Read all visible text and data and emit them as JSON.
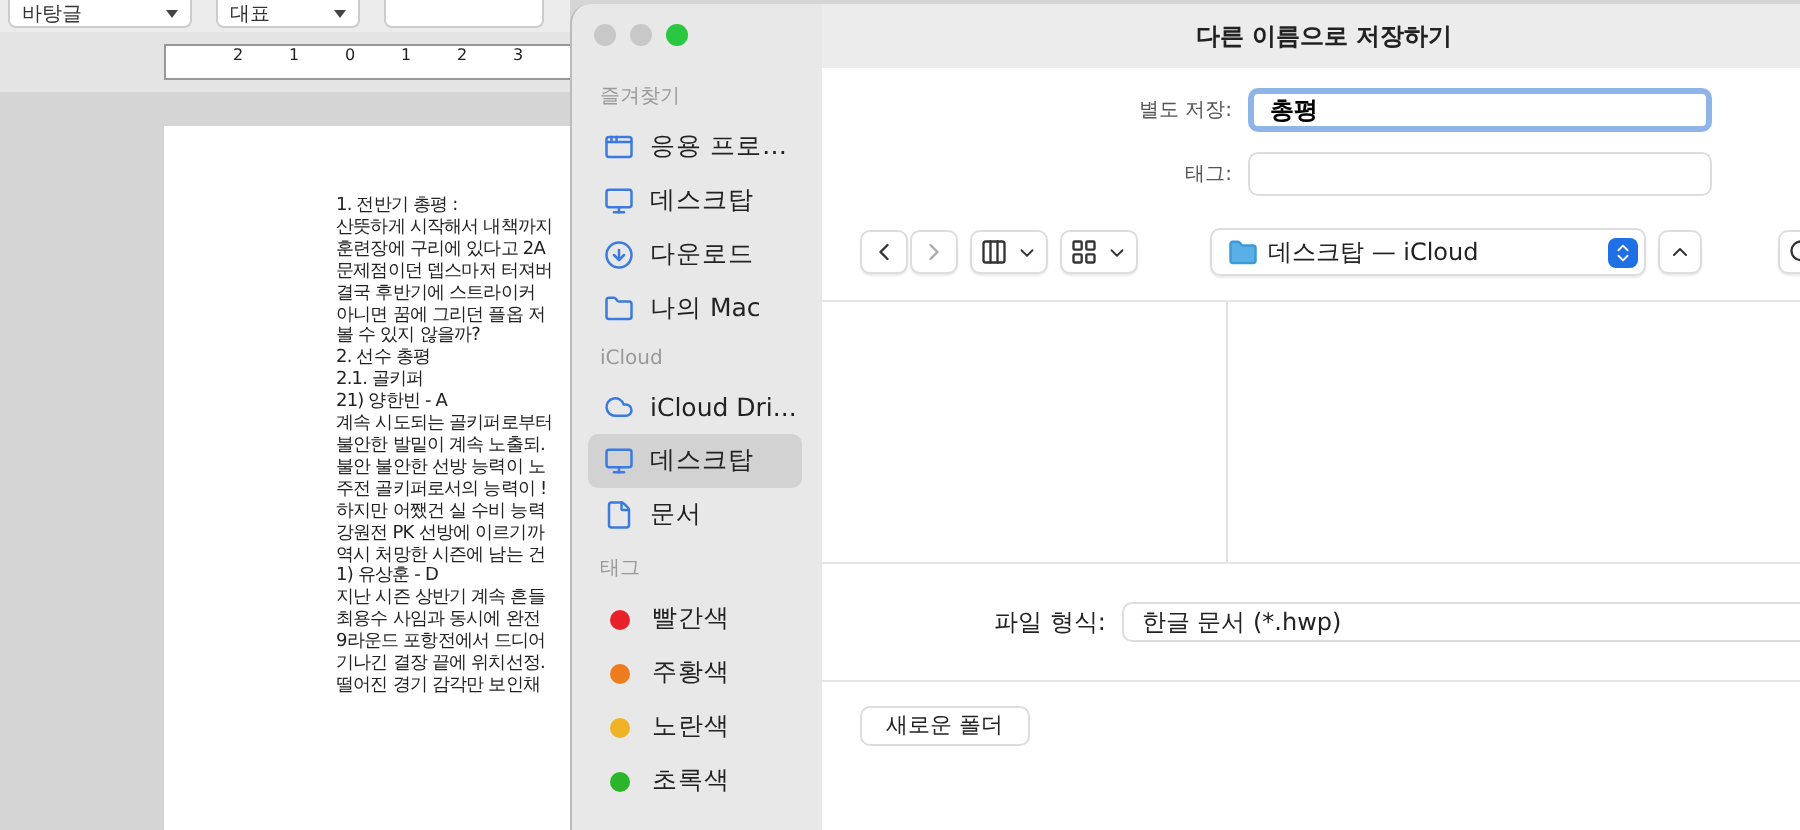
{
  "editor": {
    "toolbar": {
      "style": "바탕글",
      "outline": "대표"
    },
    "ruler_labels": [
      "2",
      "1",
      "0",
      "1",
      "2",
      "3"
    ],
    "document_lines": [
      "1. 전반기 총평 :",
      "산뜻하게 시작해서 내책까지",
      "훈련장에 구리에 있다고 2A",
      "문제점이던 뎁스마저 터져버",
      "결국 후반기에 스트라이커",
      "아니면 꿈에 그리던 플옵 저",
      "볼 수 있지 않을까?",
      "2. 선수 총평",
      "2.1. 골키퍼",
      "21) 양한빈 - A",
      "계속 시도되는 골키퍼로부터",
      "불안한 발밑이 계속 노출되.",
      "불안 불안한 선방 능력이 노",
      "주전 골키퍼로서의 능력이 !",
      "하지만 어쨌건 실 수비 능력",
      "강원전 PK 선방에 이르기까",
      "역시 처망한 시즌에 남는 건",
      "1) 유상훈 - D",
      "지난 시즌 상반기 계속 흔들",
      "최용수 사임과 동시에 완전",
      "9라운드 포항전에서 드디어",
      "기나긴 결장 끝에 위치선정.",
      "떨어진 경기 감각만 보인채"
    ]
  },
  "sidebar": {
    "sections": [
      {
        "title": "즐겨찾기",
        "items": [
          {
            "label": "응용 프로…",
            "kind": "apps",
            "selected": false
          },
          {
            "label": "데스크탑",
            "kind": "desktop",
            "selected": false
          },
          {
            "label": "다운로드",
            "kind": "download",
            "selected": false
          },
          {
            "label": "나의 Mac",
            "kind": "folder",
            "selected": false
          }
        ]
      },
      {
        "title": "iCloud",
        "items": [
          {
            "label": "iCloud Dri...",
            "kind": "cloud",
            "selected": false
          },
          {
            "label": "데스크탑",
            "kind": "desktop",
            "selected": true
          },
          {
            "label": "문서",
            "kind": "document",
            "selected": false
          }
        ]
      },
      {
        "title": "태그",
        "items": [
          {
            "label": "빨간색",
            "kind": "tag",
            "color": "#e8202a",
            "selected": false
          },
          {
            "label": "주황색",
            "kind": "tag",
            "color": "#ee7b1e",
            "selected": false
          },
          {
            "label": "노란색",
            "kind": "tag",
            "color": "#f0b323",
            "selected": false
          },
          {
            "label": "초록색",
            "kind": "tag",
            "color": "#2bb52b",
            "selected": false
          }
        ]
      }
    ]
  },
  "dialog": {
    "title": "다른 이름으로 저장하기",
    "save_as": {
      "label": "별도 저장:",
      "value": "총평"
    },
    "tags": {
      "label": "태그:"
    },
    "location": "데스크탑 — iCloud",
    "file_format": {
      "label": "파일 형식:",
      "value": "한글 문서 (*.hwp)"
    },
    "new_folder_button": "새로운 폴더"
  }
}
